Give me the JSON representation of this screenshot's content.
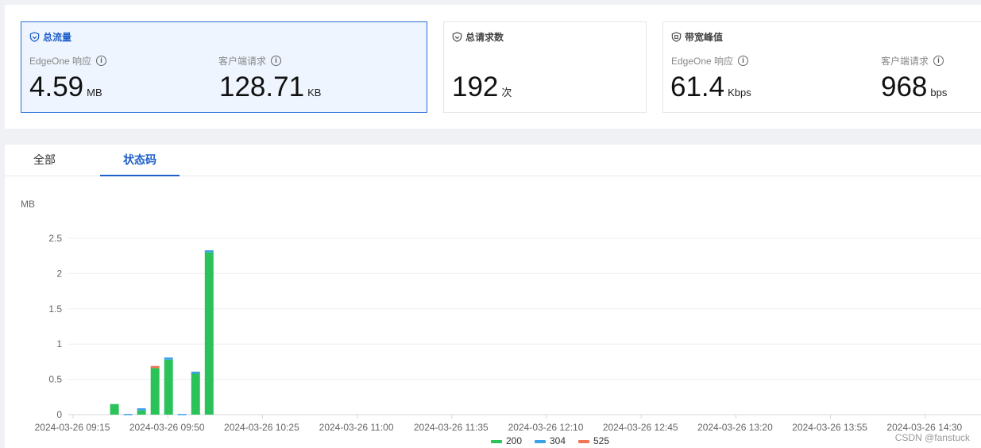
{
  "cards": [
    {
      "title": "总流量",
      "active": true,
      "metrics": [
        {
          "label": "EdgeOne 响应",
          "value": "4.59",
          "unit": "MB"
        },
        {
          "label": "客户端请求",
          "value": "128.71",
          "unit": "KB"
        }
      ]
    },
    {
      "title": "总请求数",
      "active": false,
      "metrics": [
        {
          "label": "",
          "value": "192",
          "unit": "次"
        }
      ]
    },
    {
      "title": "带宽峰值",
      "active": false,
      "metrics": [
        {
          "label": "EdgeOne 响应",
          "value": "61.4",
          "unit": "Kbps"
        },
        {
          "label": "客户端请求",
          "value": "968",
          "unit": "bps"
        }
      ]
    }
  ],
  "tabs": [
    "全部",
    "状态码"
  ],
  "active_tab": 1,
  "chart_data": {
    "type": "bar",
    "stacked": true,
    "ylabel": "MB",
    "ylim": [
      0,
      2.5
    ],
    "yticks": [
      0,
      0.5,
      1,
      1.5,
      2,
      2.5
    ],
    "xtick_labels": [
      "2024-03-26 09:15",
      "2024-03-26 09:50",
      "2024-03-26 10:25",
      "2024-03-26 11:00",
      "2024-03-26 11:35",
      "2024-03-26 12:10",
      "2024-03-26 12:45",
      "2024-03-26 13:20",
      "2024-03-26 13:55",
      "2024-03-26 14:30"
    ],
    "categories": [
      "2024-03-26 09:30",
      "2024-03-26 09:35",
      "2024-03-26 09:40",
      "2024-03-26 09:45",
      "2024-03-26 09:50",
      "2024-03-26 09:55",
      "2024-03-26 10:00",
      "2024-03-26 10:05"
    ],
    "series": [
      {
        "name": "200",
        "color": "#2bc25a",
        "values": [
          0.15,
          0.0,
          0.06,
          0.66,
          0.78,
          0.0,
          0.58,
          2.3
        ]
      },
      {
        "name": "304",
        "color": "#3ba1e6",
        "values": [
          0.0,
          0.01,
          0.03,
          0.0,
          0.03,
          0.01,
          0.03,
          0.03
        ]
      },
      {
        "name": "525",
        "color": "#f27655",
        "values": [
          0.0,
          0.0,
          0.0,
          0.03,
          0.0,
          0.0,
          0.0,
          0.0
        ]
      }
    ],
    "grid": true,
    "legend": "bottom"
  },
  "watermark": "CSDN @fanstuck",
  "colors": {
    "accent": "#1f5fc9",
    "active_card_bg": "#eef5fe"
  }
}
